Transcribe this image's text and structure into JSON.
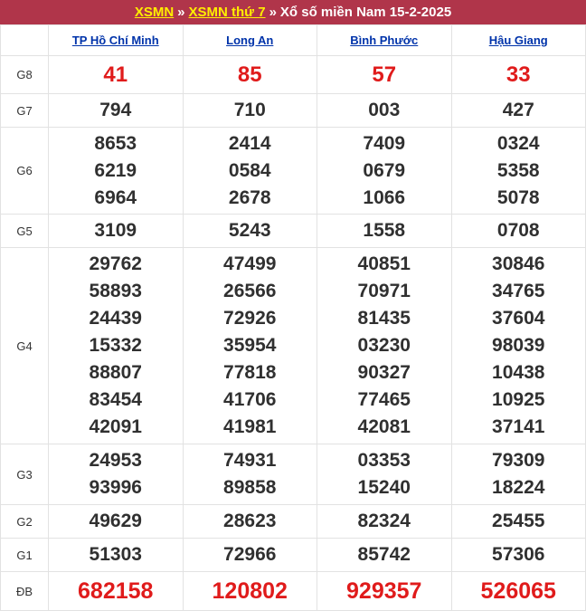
{
  "header": {
    "link1": "XSMN",
    "sep1": "»",
    "link2": "XSMN thứ 7",
    "sep2": "»",
    "title": "Xổ số miền Nam 15-2-2025"
  },
  "provinces": [
    "TP Hồ Chí Minh",
    "Long An",
    "Bình Phước",
    "Hậu Giang"
  ],
  "prizes": [
    {
      "label": "G8",
      "style": "red",
      "values": [
        [
          "41"
        ],
        [
          "85"
        ],
        [
          "57"
        ],
        [
          "33"
        ]
      ]
    },
    {
      "label": "G7",
      "style": "normal",
      "values": [
        [
          "794"
        ],
        [
          "710"
        ],
        [
          "003"
        ],
        [
          "427"
        ]
      ]
    },
    {
      "label": "G6",
      "style": "normal",
      "values": [
        [
          "8653",
          "6219",
          "6964"
        ],
        [
          "2414",
          "0584",
          "2678"
        ],
        [
          "7409",
          "0679",
          "1066"
        ],
        [
          "0324",
          "5358",
          "5078"
        ]
      ]
    },
    {
      "label": "G5",
      "style": "normal",
      "values": [
        [
          "3109"
        ],
        [
          "5243"
        ],
        [
          "1558"
        ],
        [
          "0708"
        ]
      ]
    },
    {
      "label": "G4",
      "style": "normal",
      "values": [
        [
          "29762",
          "58893",
          "24439",
          "15332",
          "88807",
          "83454",
          "42091"
        ],
        [
          "47499",
          "26566",
          "72926",
          "35954",
          "77818",
          "41706",
          "41981"
        ],
        [
          "40851",
          "70971",
          "81435",
          "03230",
          "90327",
          "77465",
          "42081"
        ],
        [
          "30846",
          "34765",
          "37604",
          "98039",
          "10438",
          "10925",
          "37141"
        ]
      ]
    },
    {
      "label": "G3",
      "style": "normal",
      "values": [
        [
          "24953",
          "93996"
        ],
        [
          "74931",
          "89858"
        ],
        [
          "03353",
          "15240"
        ],
        [
          "79309",
          "18224"
        ]
      ]
    },
    {
      "label": "G2",
      "style": "normal",
      "values": [
        [
          "49629"
        ],
        [
          "28623"
        ],
        [
          "82324"
        ],
        [
          "25455"
        ]
      ]
    },
    {
      "label": "G1",
      "style": "normal",
      "values": [
        [
          "51303"
        ],
        [
          "72966"
        ],
        [
          "85742"
        ],
        [
          "57306"
        ]
      ]
    },
    {
      "label": "ĐB",
      "style": "big",
      "values": [
        [
          "682158"
        ],
        [
          "120802"
        ],
        [
          "929357"
        ],
        [
          "526065"
        ]
      ]
    }
  ]
}
